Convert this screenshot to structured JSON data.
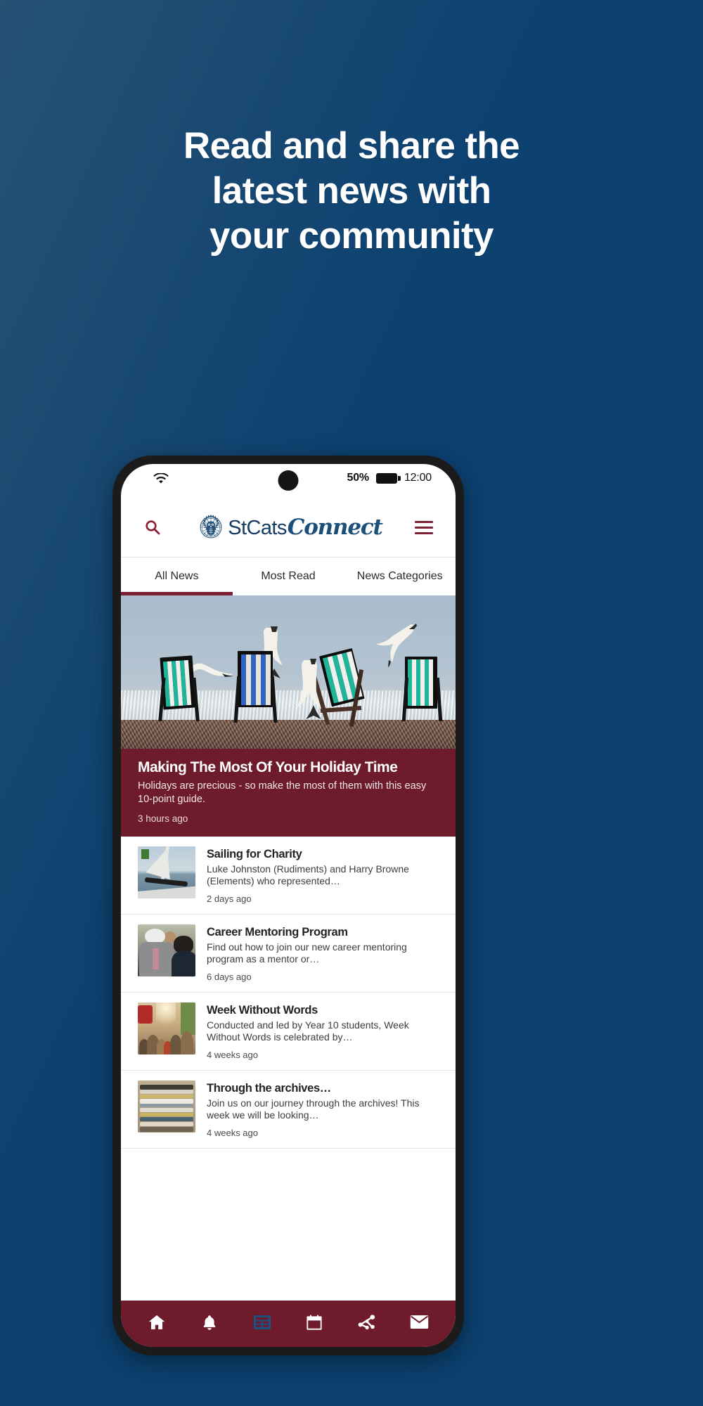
{
  "promo": {
    "headline_lines": [
      "Read and share the",
      "latest news with",
      "your community"
    ],
    "bg_color": "#0c4170",
    "accent_maroon": "#6e1b2c",
    "accent_navy": "#153c63"
  },
  "status_bar": {
    "wifi_icon": "wifi-icon",
    "battery_percent": "50%",
    "battery_icon": "battery-icon",
    "time": "12:00"
  },
  "app_header": {
    "search_icon": "search-icon",
    "menu_icon": "hamburger-menu-icon",
    "crest_icon": "owl-crest-logo-icon",
    "brand_main": "StCats",
    "brand_script": "Connect"
  },
  "tabs": [
    {
      "label": "All News",
      "active": true
    },
    {
      "label": "Most Read",
      "active": false
    },
    {
      "label": "News Categories",
      "active": false
    }
  ],
  "feature": {
    "image_alt": "deckchairs-and-seagulls-on-beach",
    "title": "Making The Most Of Your Holiday Time",
    "description": "Holidays are precious - so make the most of them with this easy 10-point guide.",
    "time": "3 hours ago"
  },
  "articles": [
    {
      "thumb": "sailing-boat-thumbnail",
      "title": "Sailing for Charity",
      "description": "Luke Johnston (Rudiments) and Harry Browne (Elements) who represented…",
      "time": "2 days ago"
    },
    {
      "thumb": "career-mentoring-thumbnail",
      "title": "Career Mentoring Program",
      "description": "Find out how to join our new career mentoring program as a mentor or…",
      "time": "6 days ago"
    },
    {
      "thumb": "crowded-street-thumbnail",
      "title": "Week Without Words",
      "description": "Conducted and led by Year 10 students, Week Without Words is celebrated by…",
      "time": "4 weeks ago"
    },
    {
      "thumb": "stacked-archives-thumbnail",
      "title": "Through the archives…",
      "description": "Join us on our journey through the archives! This week we will be looking…",
      "time": "4 weeks ago"
    }
  ],
  "bottom_nav": [
    {
      "icon": "home-icon",
      "active": false
    },
    {
      "icon": "bell-icon",
      "active": false
    },
    {
      "icon": "news-list-icon",
      "active": true
    },
    {
      "icon": "calendar-icon",
      "active": false
    },
    {
      "icon": "share-network-icon",
      "active": false
    },
    {
      "icon": "envelope-icon",
      "active": false
    }
  ]
}
